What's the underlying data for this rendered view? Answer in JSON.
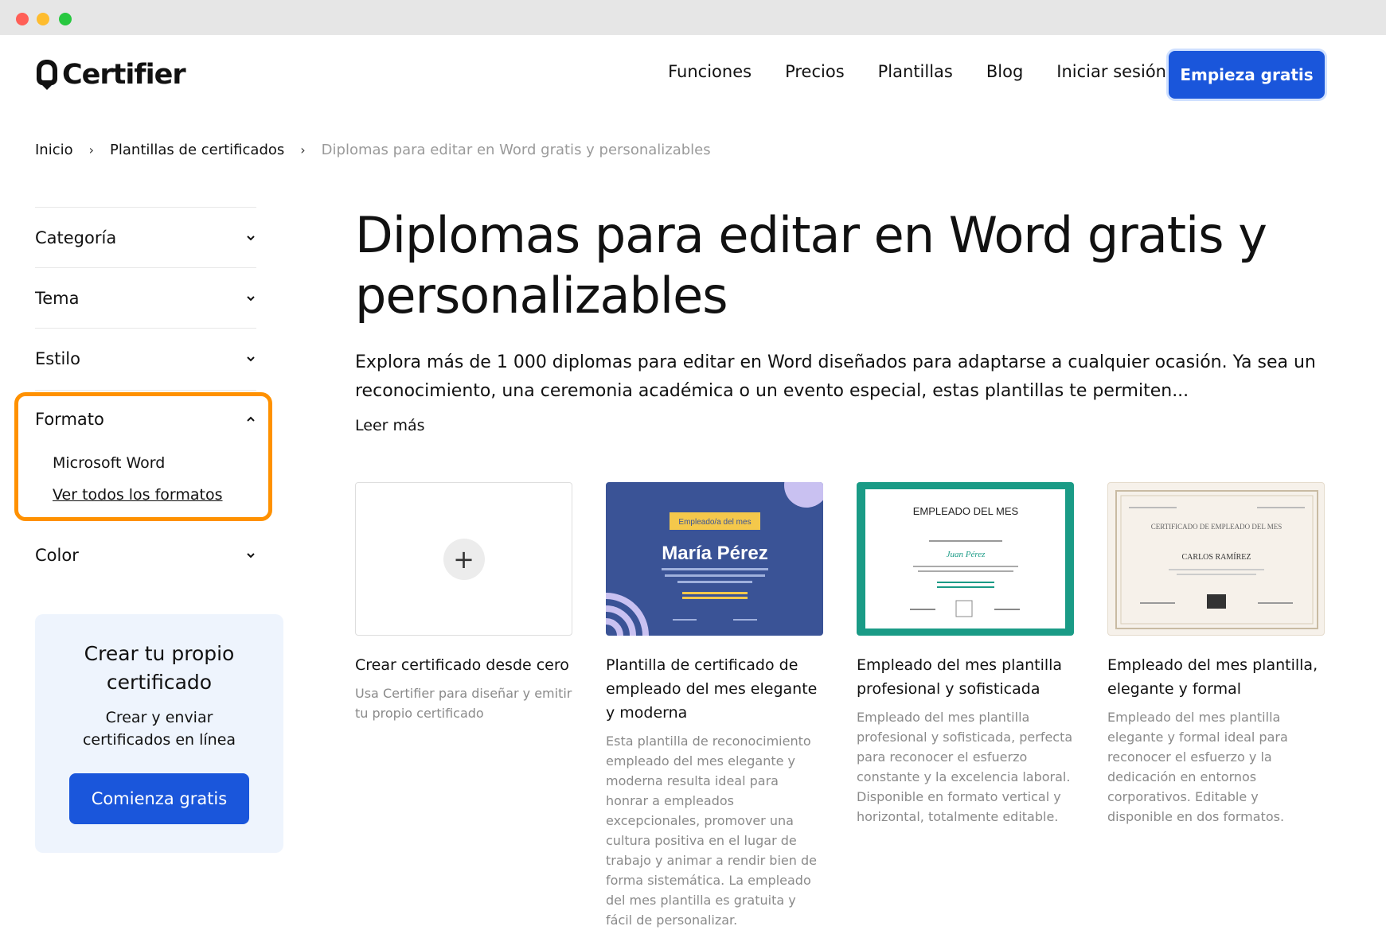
{
  "brand": {
    "name": "Certifier"
  },
  "nav": {
    "items": [
      "Funciones",
      "Precios",
      "Plantillas",
      "Blog",
      "Iniciar sesión"
    ],
    "cta": "Empieza gratis"
  },
  "breadcrumb": {
    "items": [
      "Inicio",
      "Plantillas de certificados"
    ],
    "current": "Diplomas para editar en Word gratis y personalizables"
  },
  "filters": {
    "categoria": "Categoría",
    "tema": "Tema",
    "estilo": "Estilo",
    "formato": "Formato",
    "formato_options": [
      "Microsoft Word",
      "Ver todos los formatos"
    ],
    "color": "Color"
  },
  "promo": {
    "title": "Crear tu propio certificado",
    "subtitle": "Crear y enviar certificados en línea",
    "button": "Comienza gratis"
  },
  "main": {
    "title": "Diplomas para editar en Word gratis y personalizables",
    "description": "Explora más de 1 000 diplomas para editar en Word diseñados para adaptarse a cualquier ocasión. Ya sea un reconocimiento, una ceremonia académica o un evento especial, estas plantillas te permiten...",
    "read_more": "Leer más"
  },
  "cards": [
    {
      "title": "Crear certificado desde cero",
      "desc": "Usa Certifier para diseñar y emitir tu propio certificado"
    },
    {
      "title": "Plantilla de certificado de empleado del mes elegante y moderna",
      "desc": "Esta plantilla de reconocimiento empleado del mes elegante y moderna resulta ideal para honrar a empleados excepcionales, promover una cultura positiva en el lugar de trabajo y animar a rendir bien de forma sistemática. La empleado del mes plantilla es gratuita y fácil de personalizar.",
      "thumb_badge": "Empleado/a del mes",
      "thumb_name": "María Pérez"
    },
    {
      "title": "Empleado del mes plantilla profesional y sofisticada",
      "desc": "Empleado del mes plantilla profesional y sofisticada, perfecta para reconocer el esfuerzo constante y la excelencia laboral. Disponible en formato vertical y horizontal, totalmente editable.",
      "thumb_heading": "EMPLEADO DEL MES",
      "thumb_name": "Juan Pérez"
    },
    {
      "title": "Empleado del mes plantilla, elegante y formal",
      "desc": "Empleado del mes plantilla elegante y formal ideal para reconocer el esfuerzo y la dedicación en entornos corporativos. Editable y disponible en dos formatos.",
      "thumb_heading": "CERTIFICADO DE EMPLEADO DEL MES",
      "thumb_name": "CARLOS RAMÍREZ"
    }
  ]
}
